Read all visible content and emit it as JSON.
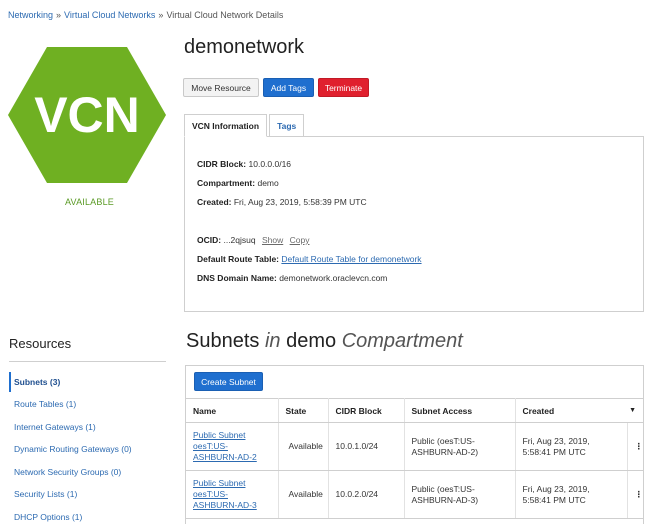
{
  "breadcrumb": {
    "items": [
      "Networking",
      "Virtual Cloud Networks",
      "Virtual Cloud Network Details"
    ],
    "separator": "»"
  },
  "logo": {
    "text": "VCN",
    "color": "#6fb022"
  },
  "status": {
    "text": "AVAILABLE",
    "color": "#5a9a25"
  },
  "title": "demonetwork",
  "actions": {
    "move": "Move Resource",
    "add_tags": "Add Tags",
    "terminate": "Terminate"
  },
  "tabs": {
    "info": "VCN Information",
    "tags": "Tags"
  },
  "info": {
    "cidr_label": "CIDR Block:",
    "cidr_value": "10.0.0.0/16",
    "compartment_label": "Compartment:",
    "compartment_value": "demo",
    "created_label": "Created:",
    "created_value": "Fri, Aug 23, 2019, 5:58:39 PM UTC",
    "ocid_label": "OCID:",
    "ocid_value": "...2qjsuq",
    "ocid_show": "Show",
    "ocid_copy": "Copy",
    "route_label": "Default Route Table:",
    "route_value": "Default Route Table for demonetwork",
    "dns_label": "DNS Domain Name:",
    "dns_value": "demonetwork.oraclevcn.com"
  },
  "resources": {
    "title": "Resources",
    "items": [
      "Subnets (3)",
      "Route Tables (1)",
      "Internet Gateways (1)",
      "Dynamic Routing Gateways (0)",
      "Network Security Groups (0)",
      "Security Lists (1)",
      "DHCP Options (1)"
    ]
  },
  "subnets": {
    "title_main": "Subnets",
    "title_in": "in",
    "title_compartment": "demo",
    "title_suffix": "Compartment",
    "create_button": "Create Subnet",
    "columns": [
      "Name",
      "State",
      "CIDR Block",
      "Subnet Access",
      "Created"
    ],
    "rows": [
      {
        "name": "Public Subnet oesT:US-ASHBURN-AD-2",
        "state": "Available",
        "cidr": "10.0.1.0/24",
        "access": "Public (oesT:US-ASHBURN-AD-2)",
        "created": "Fri, Aug 23, 2019, 5:58:41 PM UTC"
      },
      {
        "name": "Public Subnet oesT:US-ASHBURN-AD-3",
        "state": "Available",
        "cidr": "10.0.2.0/24",
        "access": "Public (oesT:US-ASHBURN-AD-3)",
        "created": "Fri, Aug 23, 2019, 5:58:41 PM UTC"
      }
    ],
    "state_color": "#3a9a3a"
  }
}
